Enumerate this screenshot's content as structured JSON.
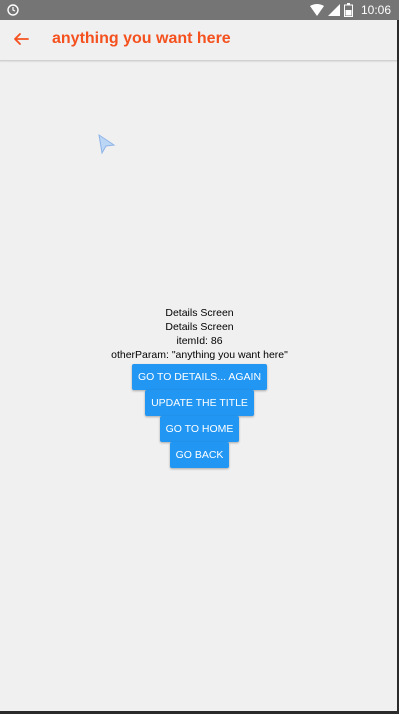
{
  "status_bar": {
    "time": "10:06",
    "icons": [
      "notification-sync-icon",
      "wifi-icon",
      "signal-icon",
      "battery-icon"
    ]
  },
  "header": {
    "title": "anything you want here",
    "back_icon": "arrow-left-icon",
    "accent_color": "#f4511e"
  },
  "main": {
    "lines": [
      "Details Screen",
      "Details Screen",
      "itemId: 86",
      "otherParam: \"anything you want here\""
    ],
    "buttons": [
      "GO TO DETAILS... AGAIN",
      "UPDATE THE TITLE",
      "GO TO HOME",
      "GO BACK"
    ],
    "button_color": "#2196f3"
  }
}
